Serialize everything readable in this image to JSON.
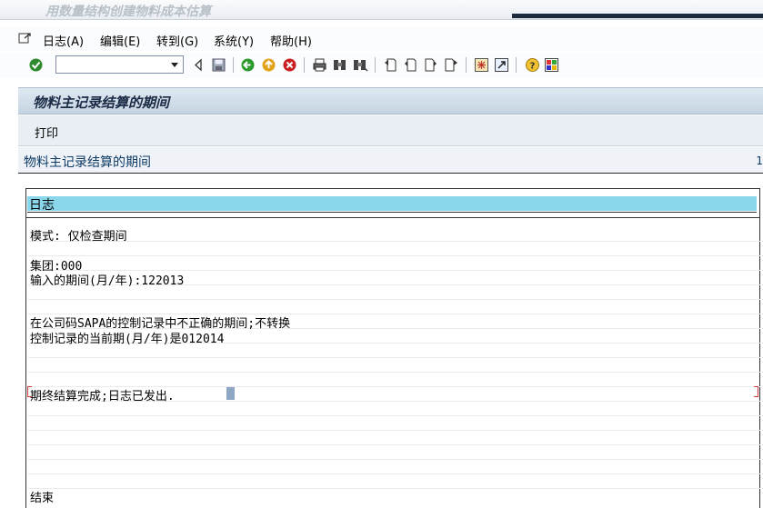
{
  "title_bar": {
    "text": "用数量结构创建物料成本估算"
  },
  "menu": {
    "items": [
      {
        "label": "日志(A)"
      },
      {
        "label": "编辑(E)"
      },
      {
        "label": "转到(G)"
      },
      {
        "label": "系统(Y)"
      },
      {
        "label": "帮助(H)"
      }
    ]
  },
  "toolbar": {
    "command_value": "",
    "icons": [
      "enter-icon",
      "save-icon",
      "back-icon",
      "exit-icon",
      "cancel-icon",
      "print-icon",
      "find-icon",
      "find-next-icon",
      "first-page-icon",
      "prev-page-icon",
      "next-page-icon",
      "last-page-icon",
      "create-session-icon",
      "shortcut-icon",
      "help-icon",
      "layout-icon"
    ]
  },
  "screen": {
    "title": "物料主记录结算的期间"
  },
  "app_toolbar": {
    "print_label": "打印"
  },
  "list": {
    "header": "物料主记录结算的期间",
    "page_indicator": "1",
    "log_title": "日志",
    "lines": {
      "mode": "模式: 仅检查期间",
      "group": "集团:000",
      "period": "输入的期间(月/年):122013",
      "wrong_period": "在公司码SAPA的控制记录中不正确的期间;不转换",
      "current_period": "控制记录的当前期(月/年)是012014",
      "done": "期终结算完成;日志已发出.",
      "end": "结束"
    }
  },
  "colors": {
    "log_header_bg": "#8ad6ea",
    "screen_title_bg": "#c5d4e3",
    "text_blue": "#0e3a66"
  }
}
